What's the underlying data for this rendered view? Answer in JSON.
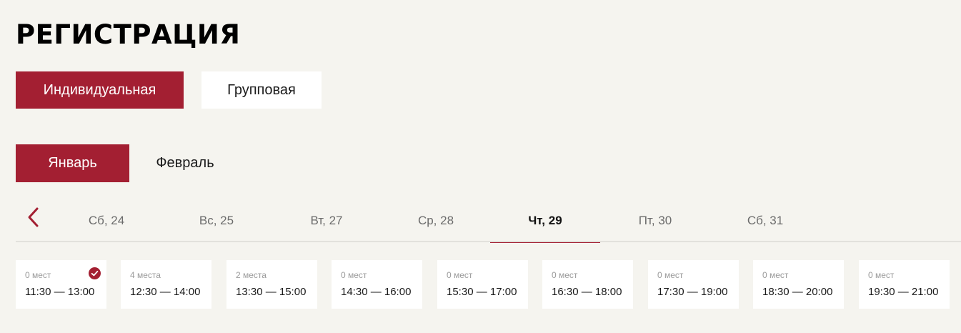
{
  "page": {
    "title": "РЕГИСТРАЦИЯ"
  },
  "registration_type": {
    "options": [
      {
        "label": "Индивидуальная",
        "selected": true
      },
      {
        "label": "Групповая",
        "selected": false
      }
    ]
  },
  "months": {
    "options": [
      {
        "label": "Январь",
        "selected": true
      },
      {
        "label": "Февраль",
        "selected": false
      }
    ]
  },
  "days": {
    "prev_icon": "chevron-left-icon",
    "items": [
      {
        "label": "Сб, 24",
        "selected": false
      },
      {
        "label": "Вс, 25",
        "selected": false
      },
      {
        "label": "Вт, 27",
        "selected": false
      },
      {
        "label": "Ср, 28",
        "selected": false
      },
      {
        "label": "Чт, 29",
        "selected": true
      },
      {
        "label": "Пт, 30",
        "selected": false
      },
      {
        "label": "Сб, 31",
        "selected": false
      }
    ]
  },
  "slots": [
    {
      "places": "0 мест",
      "time": "11:30 — 13:00",
      "checked": true
    },
    {
      "places": "4 места",
      "time": "12:30 — 14:00",
      "checked": false
    },
    {
      "places": "2 места",
      "time": "13:30 — 15:00",
      "checked": false
    },
    {
      "places": "0 мест",
      "time": "14:30 — 16:00",
      "checked": false
    },
    {
      "places": "0 мест",
      "time": "15:30 — 17:00",
      "checked": false
    },
    {
      "places": "0 мест",
      "time": "16:30 — 18:00",
      "checked": false
    },
    {
      "places": "0 мест",
      "time": "17:30 — 19:00",
      "checked": false
    },
    {
      "places": "0 мест",
      "time": "18:30 — 20:00",
      "checked": false
    },
    {
      "places": "0 мест",
      "time": "19:30 — 21:00",
      "checked": false
    }
  ],
  "colors": {
    "accent": "#a31f32",
    "background": "#f5f4ef",
    "card": "#ffffff",
    "muted_text": "#9a9a9a"
  }
}
